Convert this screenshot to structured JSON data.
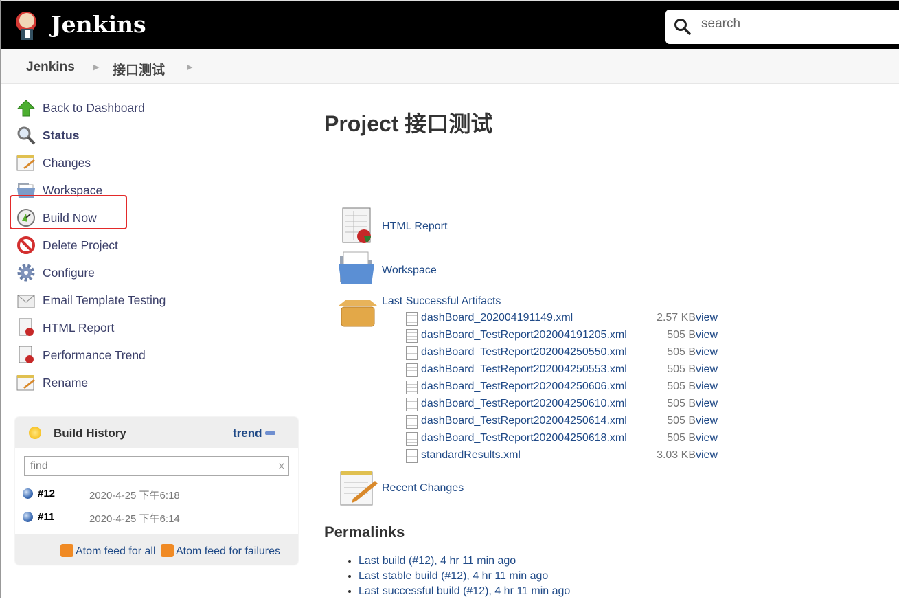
{
  "header": {
    "brand": "Jenkins",
    "search_placeholder": "search"
  },
  "breadcrumb": [
    "Jenkins",
    "接口测试"
  ],
  "sidebar": {
    "items": [
      {
        "label": "Back to Dashboard",
        "icon": "up-arrow-icon"
      },
      {
        "label": "Status",
        "icon": "magnifier-icon"
      },
      {
        "label": "Changes",
        "icon": "notepad-icon"
      },
      {
        "label": "Workspace",
        "icon": "folder-icon"
      },
      {
        "label": "Build Now",
        "icon": "clock-icon"
      },
      {
        "label": "Delete Project",
        "icon": "no-entry-icon"
      },
      {
        "label": "Configure",
        "icon": "gear-icon"
      },
      {
        "label": "Email Template Testing",
        "icon": "envelope-icon"
      },
      {
        "label": "HTML Report",
        "icon": "report-icon"
      },
      {
        "label": "Performance Trend",
        "icon": "report-icon"
      },
      {
        "label": "Rename",
        "icon": "notepad-icon"
      }
    ],
    "highlight_color": "#e32a2a"
  },
  "build_history": {
    "title": "Build History",
    "trend": "trend",
    "find_placeholder": "find",
    "clear": "x",
    "builds": [
      {
        "number": "#12",
        "date": "2020-4-25 下午6:18"
      },
      {
        "number": "#11",
        "date": "2020-4-25 下午6:14"
      }
    ],
    "feed_all": "Atom feed for all",
    "feed_failures": "Atom feed for failures"
  },
  "main": {
    "title": "Project 接口测试",
    "html_report": "HTML Report",
    "workspace": "Workspace",
    "artifacts_title": "Last Successful Artifacts",
    "artifacts": [
      {
        "name": "dashBoard_202004191149.xml",
        "size": "2.57 KB",
        "view": "view"
      },
      {
        "name": "dashBoard_TestReport202004191205.xml",
        "size": "505 B",
        "view": "view"
      },
      {
        "name": "dashBoard_TestReport202004250550.xml",
        "size": "505 B",
        "view": "view"
      },
      {
        "name": "dashBoard_TestReport202004250553.xml",
        "size": "505 B",
        "view": "view"
      },
      {
        "name": "dashBoard_TestReport202004250606.xml",
        "size": "505 B",
        "view": "view"
      },
      {
        "name": "dashBoard_TestReport202004250610.xml",
        "size": "505 B",
        "view": "view"
      },
      {
        "name": "dashBoard_TestReport202004250614.xml",
        "size": "505 B",
        "view": "view"
      },
      {
        "name": "dashBoard_TestReport202004250618.xml",
        "size": "505 B",
        "view": "view"
      },
      {
        "name": "standardResults.xml",
        "size": "3.03 KB",
        "view": "view"
      }
    ],
    "recent_changes": "Recent Changes",
    "permalinks_title": "Permalinks",
    "permalinks": [
      "Last build (#12), 4 hr 11 min ago",
      "Last stable build (#12), 4 hr 11 min ago",
      "Last successful build (#12), 4 hr 11 min ago"
    ]
  }
}
